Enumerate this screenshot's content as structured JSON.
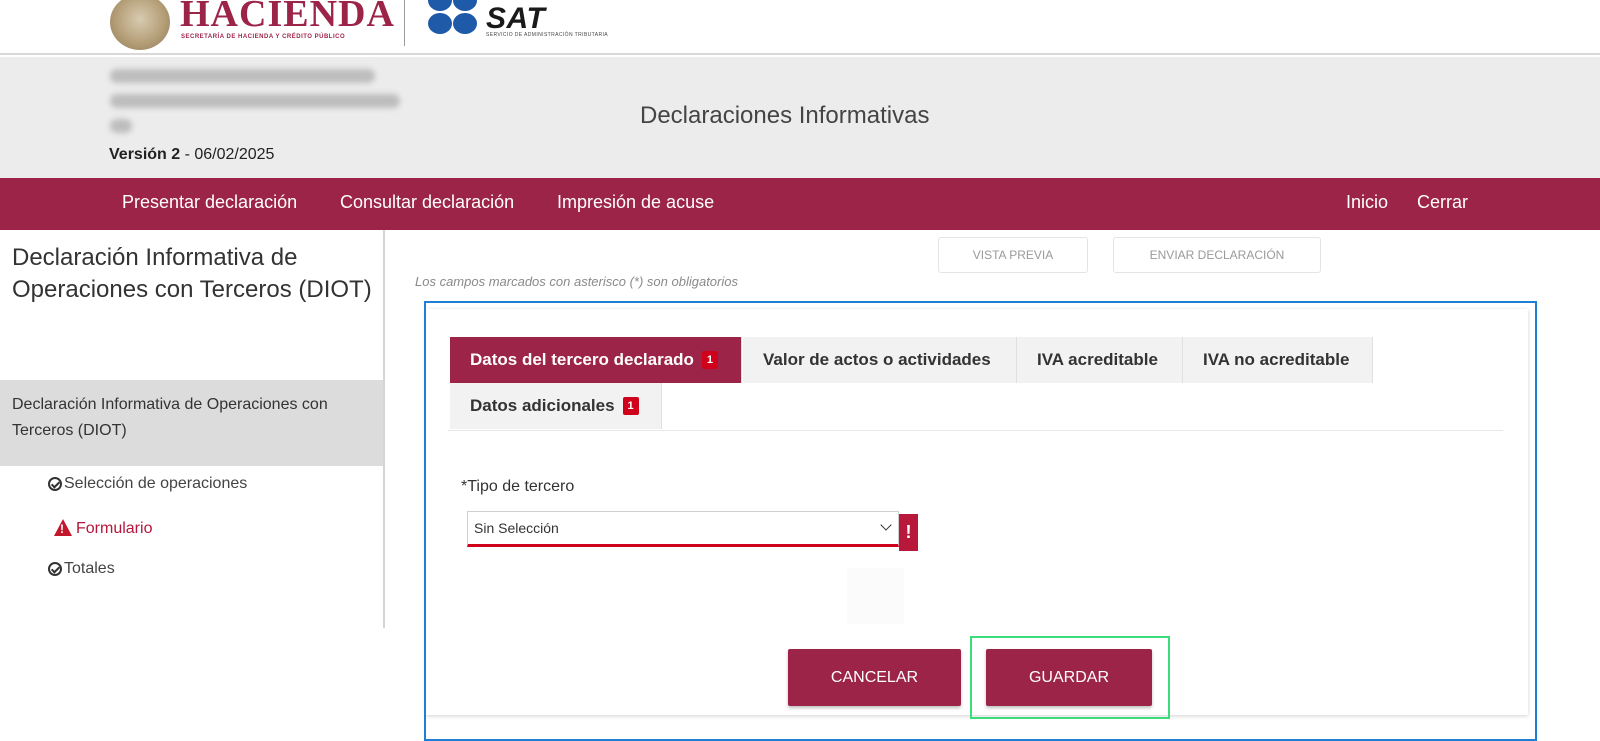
{
  "logos": {
    "hacienda_title": "HACIENDA",
    "hacienda_subtitle": "SECRETARÍA DE HACIENDA Y CRÉDITO PÚBLICO",
    "sat_title": "SAT",
    "sat_subtitle": "SERVICIO DE ADMINISTRACIÓN TRIBUTARIA"
  },
  "header": {
    "version_label": "Versión 2",
    "version_date": " - 06/02/2025",
    "title": "Declaraciones Informativas"
  },
  "nav": {
    "items": [
      "Presentar declaración",
      "Consultar declaración",
      "Impresión de acuse"
    ],
    "inicio": "Inicio",
    "cerrar": "Cerrar"
  },
  "sidebar": {
    "title": "Declaración Informativa de Operaciones con Terceros (DIOT)",
    "section": "Declaración Informativa de Operaciones con Terceros (DIOT)",
    "steps": [
      "Selección de operaciones",
      "Formulario",
      "Totales"
    ]
  },
  "toolbar": {
    "preview": "VISTA PREVIA",
    "send": "ENVIAR DECLARACIÓN",
    "required_note": "Los campos marcados con asterisco (*) son obligatorios"
  },
  "tabs": [
    {
      "label": "Datos del tercero declarado",
      "badge": "1"
    },
    {
      "label": "Valor de actos o actividades"
    },
    {
      "label": "IVA acreditable"
    },
    {
      "label": "IVA no acreditable"
    },
    {
      "label": "Datos adicionales",
      "badge": "1"
    }
  ],
  "form": {
    "tipo_label": "*Tipo de tercero",
    "tipo_value": "Sin Selección",
    "error_mark": "!"
  },
  "actions": {
    "cancel": "CANCELAR",
    "save": "GUARDAR"
  },
  "colors": {
    "brand_maroon": "#9d2449",
    "error_red": "#d0021b",
    "focus_blue": "#1f7fd4",
    "highlight_green": "#3bdc7a"
  }
}
